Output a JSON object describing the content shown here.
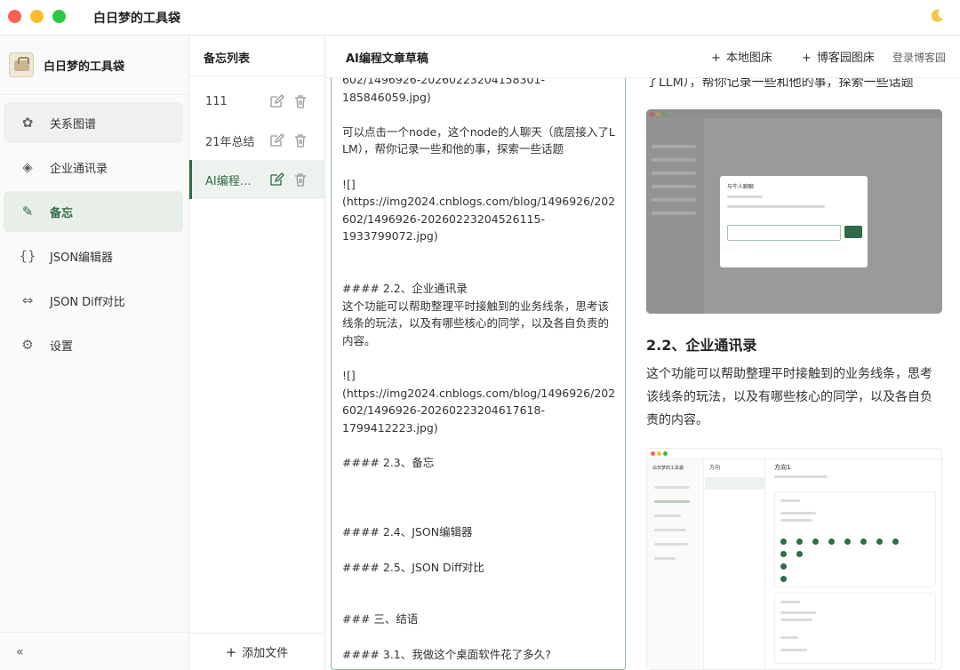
{
  "app": {
    "window_title": "白日梦的工具袋",
    "theme_icon": "moon-icon"
  },
  "sidebar": {
    "brand_name": "白日梦的工具袋",
    "items": [
      {
        "label": "关系图谱",
        "icon": "openai-knot-icon",
        "glyph": "✿"
      },
      {
        "label": "企业通讯录",
        "icon": "diamond-icon",
        "glyph": "◈"
      },
      {
        "label": "备忘",
        "icon": "pencil-icon",
        "glyph": "✎"
      },
      {
        "label": "JSON编辑器",
        "icon": "braces-icon",
        "glyph": "{}"
      },
      {
        "label": "JSON Diff对比",
        "icon": "double-arrow-icon",
        "glyph": "⇔"
      },
      {
        "label": "设置",
        "icon": "gear-icon",
        "glyph": "⚙"
      }
    ],
    "collapse_glyph": "«"
  },
  "memo_list": {
    "title": "备忘列表",
    "items": [
      {
        "label": "111"
      },
      {
        "label": "21年总结"
      },
      {
        "label": "AI编程文章草稿"
      }
    ],
    "add_file_label": "添加文件",
    "add_file_plus": "+"
  },
  "main": {
    "doc_title": "AI编程文章草稿",
    "local_image_host": "本地图床",
    "cnblogs_image_host": "博客园图床",
    "login_cnblogs": "登录博客园",
    "plus": "+"
  },
  "editor": {
    "content": "602/1496926-20260223204158301-\n185846059.jpg)\n\n可以点击一个node，这个node的人聊天（底层接入了LLM），帮你记录一些和他的事，探索一些话题\n\n![]\n(https://img2024.cnblogs.com/blog/1496926/202602/1496926-20260223204526115-\n1933799072.jpg)\n\n\n#### 2.2、企业通讯录\n这个功能可以帮助整理平时接触到的业务线条，思考该线条的玩法，以及有哪些核心的同学，以及各自负责的内容。\n\n![]\n(https://img2024.cnblogs.com/blog/1496926/202602/1496926-20260223204617618-\n1799412223.jpg)\n\n#### 2.3、备忘\n\n\n\n#### 2.4、JSON编辑器\n\n#### 2.5、JSON Diff对比\n\n\n### 三、结语\n\n#### 3.1、我做这个桌面软件花了多久?"
  },
  "preview": {
    "top_line": "了LLM），帮你记录一些和他的事，探索一些话题",
    "heading": "2.2、企业通讯录",
    "paragraph": "这个功能可以帮助整理平时接触到的业务线条，思考该线条的玩法，以及有哪些核心的同学，以及各自负责的内容。",
    "shot1": {
      "modal_title": "与牛人聊聊"
    },
    "shot2": {
      "app_name": "白日梦的工具袋",
      "list_header": "方向",
      "card_title": "方向1"
    }
  }
}
